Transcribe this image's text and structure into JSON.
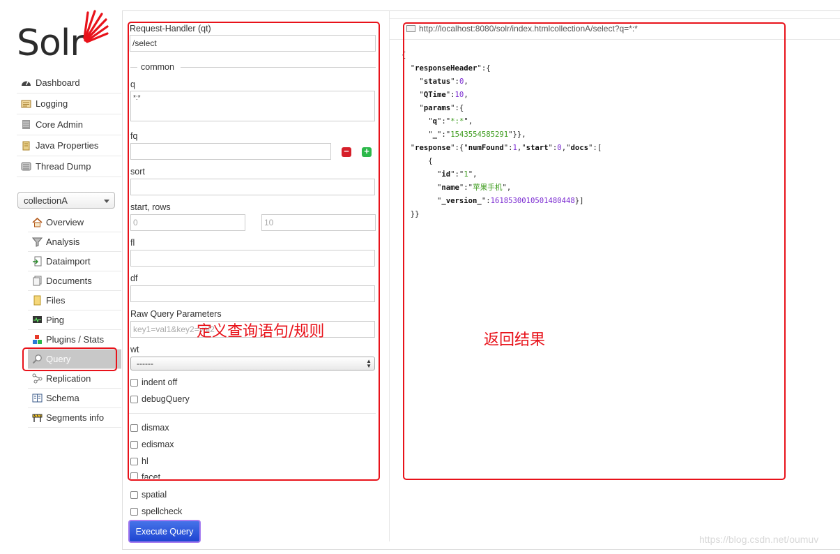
{
  "brand": {
    "name": "Solr",
    "accent": "#e8121a"
  },
  "nav": [
    {
      "label": "Dashboard",
      "icon": "dashboard-icon"
    },
    {
      "label": "Logging",
      "icon": "logging-icon"
    },
    {
      "label": "Core Admin",
      "icon": "core-admin-icon"
    },
    {
      "label": "Java Properties",
      "icon": "java-icon"
    },
    {
      "label": "Thread Dump",
      "icon": "thread-dump-icon"
    }
  ],
  "core_selector": {
    "selected": "collectionA"
  },
  "core_menu": [
    {
      "label": "Overview",
      "icon": "home-icon"
    },
    {
      "label": "Analysis",
      "icon": "funnel-icon"
    },
    {
      "label": "Dataimport",
      "icon": "dataimport-icon"
    },
    {
      "label": "Documents",
      "icon": "documents-icon"
    },
    {
      "label": "Files",
      "icon": "folder-icon"
    },
    {
      "label": "Ping",
      "icon": "ping-icon"
    },
    {
      "label": "Plugins / Stats",
      "icon": "plugins-icon"
    },
    {
      "label": "Query",
      "icon": "magnifier-icon",
      "active": true
    },
    {
      "label": "Replication",
      "icon": "replication-icon"
    },
    {
      "label": "Schema",
      "icon": "schema-icon"
    },
    {
      "label": "Segments info",
      "icon": "segments-icon"
    }
  ],
  "form": {
    "request_handler_label": "Request-Handler (qt)",
    "request_handler_value": "/select",
    "common_legend": "common",
    "q_label": "q",
    "q_value": "*:*",
    "fq_label": "fq",
    "fq_value": "",
    "sort_label": "sort",
    "sort_value": "",
    "start_rows_label": "start, rows",
    "start_placeholder": "0",
    "rows_placeholder": "10",
    "fl_label": "fl",
    "fl_value": "",
    "df_label": "df",
    "df_value": "",
    "raw_label": "Raw Query Parameters",
    "raw_placeholder": "key1=val1&key2=val2",
    "wt_label": "wt",
    "wt_value": "------",
    "indent_label": "indent off",
    "debug_label": "debugQuery",
    "dismax_label": "dismax",
    "edismax_label": "edismax",
    "hl_label": "hl",
    "facet_label": "facet",
    "spatial_label": "spatial",
    "spellcheck_label": "spellcheck",
    "execute_label": "Execute Query"
  },
  "result": {
    "url": "http://localhost:8080/solr/index.htmlcollectionA/select?q=*:*",
    "response": {
      "status": "0",
      "qtime": "10",
      "q": "*:*",
      "underscore": "1543554585291",
      "numFound": "1",
      "start": "0",
      "id": "1",
      "name": "苹果手机",
      "version": "1618530010501480448"
    }
  },
  "annotations": {
    "form_note": "定义查询语句/规则",
    "result_note": "返回结果",
    "color": "#e8121a"
  },
  "watermark": "https://blog.csdn.net/oumuv"
}
